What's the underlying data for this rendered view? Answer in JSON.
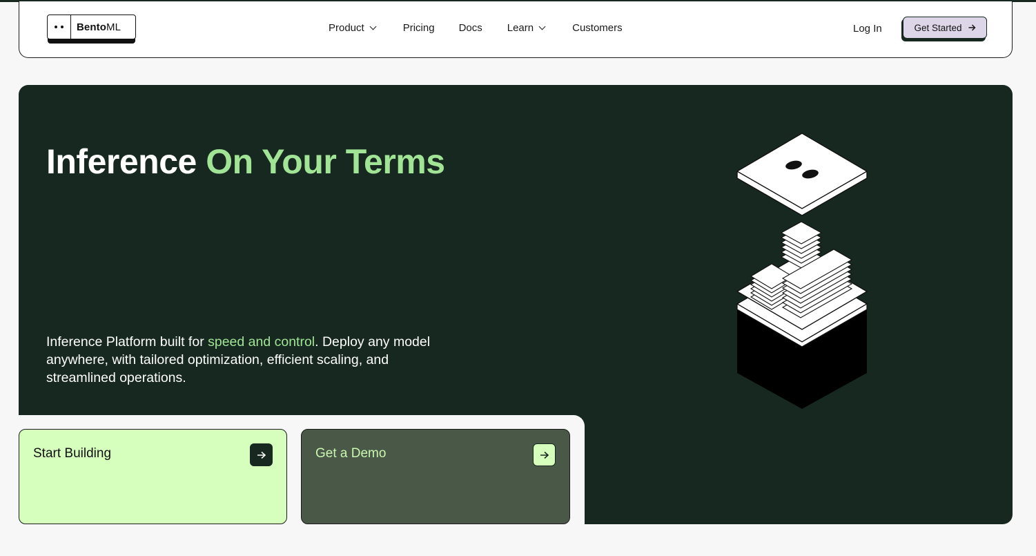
{
  "brand": {
    "name_bold": "Bento",
    "name_rest": "ML"
  },
  "nav": {
    "items": [
      {
        "label": "Product",
        "has_dropdown": true
      },
      {
        "label": "Pricing",
        "has_dropdown": false
      },
      {
        "label": "Docs",
        "has_dropdown": false
      },
      {
        "label": "Learn",
        "has_dropdown": true
      },
      {
        "label": "Customers",
        "has_dropdown": false
      }
    ],
    "login": "Log In",
    "cta": "Get Started"
  },
  "hero": {
    "title_part1": "Inference ",
    "title_part2": "On Your Terms",
    "sub_part1": "Inference Platform built for ",
    "sub_highlight": "speed and control",
    "sub_part2": ". Deploy any model anywhere, with tailored optimization, efficient scaling, and streamlined operations."
  },
  "cards": [
    {
      "label": "Start Building",
      "icon": "arrow-right-icon"
    },
    {
      "label": "Get a Demo",
      "icon": "arrow-right-icon"
    }
  ],
  "colors": {
    "dark_green": "#16281f",
    "accent_green": "#a2e496",
    "light_green": "#d6ffbe",
    "mid_green": "#4a5848",
    "cta_lavender": "#dcd6e8"
  }
}
